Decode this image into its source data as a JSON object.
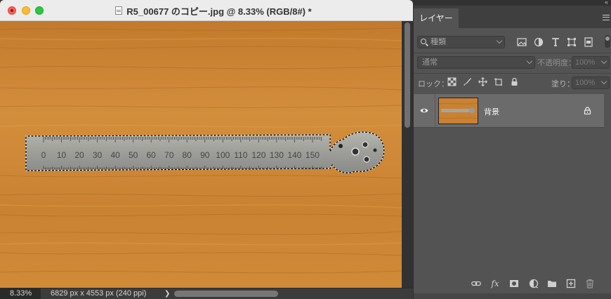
{
  "document": {
    "title": "R5_00677 のコピー.jpg @ 8.33% (RGB/8#) *",
    "zoom": "8.33%",
    "image_info": "6829 px x 4553 px (240 ppi)",
    "status_arrow": "❯",
    "canvas_content": "wooden table with metal ruler (selection active)",
    "ruler_labels": [
      "0",
      "10",
      "20",
      "30",
      "40",
      "50",
      "60",
      "70",
      "80",
      "90",
      "100",
      "110",
      "120",
      "130",
      "140",
      "150"
    ]
  },
  "layers_panel": {
    "collapse_glyph": "«",
    "tab_label": "レイヤー",
    "filter": {
      "value": "種類"
    },
    "filter_icons": [
      "image-filter-icon",
      "adjustment-filter-icon",
      "text-filter-icon",
      "shape-filter-icon",
      "smart-object-filter-icon"
    ],
    "blend_mode": "通常",
    "opacity_label": "不透明度：",
    "opacity_value": "100%",
    "lock_label": "ロック：",
    "lock_icons": [
      "lock-transparent-pixels-icon",
      "lock-image-pixels-icon",
      "lock-position-icon",
      "lock-artboard-icon",
      "lock-all-icon"
    ],
    "fill_label": "塗り：",
    "fill_value": "100%",
    "layers": [
      {
        "name": "背景",
        "visible": true,
        "locked": true
      }
    ],
    "footer_icons": [
      "link-layers-icon",
      "fx-icon",
      "add-mask-icon",
      "adjustment-layer-icon",
      "group-folder-icon",
      "new-layer-icon",
      "delete-layer-icon"
    ],
    "fx_label": "fx"
  },
  "colors": {
    "wood": "#c98232",
    "panel_bg": "#535353",
    "selected_layer": "#6b6b6b"
  }
}
